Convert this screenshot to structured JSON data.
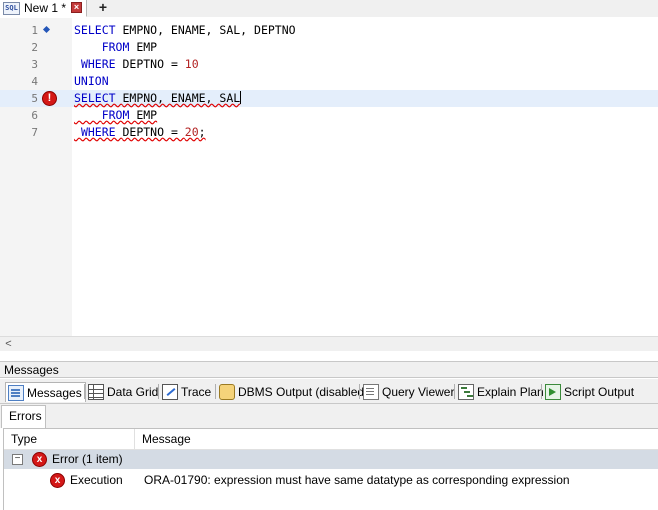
{
  "document_tab": {
    "icon": "sql-file-icon",
    "icon_text": "SQL",
    "title": "New 1 *",
    "close_glyph": "×",
    "add_glyph": "+"
  },
  "editor": {
    "lines": [
      {
        "number": "1",
        "marker": "bookmark",
        "segments": [
          {
            "text": "SELECT ",
            "cls": "kw"
          },
          {
            "text": "EMPNO, ENAME, SAL, DEPTNO",
            "cls": ""
          }
        ]
      },
      {
        "number": "2",
        "marker": "",
        "segments": [
          {
            "text": "    ",
            "cls": ""
          },
          {
            "text": "FROM ",
            "cls": "kw"
          },
          {
            "text": "EMP",
            "cls": ""
          }
        ]
      },
      {
        "number": "3",
        "marker": "",
        "segments": [
          {
            "text": " ",
            "cls": ""
          },
          {
            "text": "WHERE ",
            "cls": "kw"
          },
          {
            "text": "DEPTNO = ",
            "cls": ""
          },
          {
            "text": "10",
            "cls": "num"
          }
        ]
      },
      {
        "number": "4",
        "marker": "",
        "segments": [
          {
            "text": "UNION",
            "cls": "kw"
          }
        ]
      },
      {
        "number": "5",
        "marker": "error",
        "current": true,
        "segments": [
          {
            "text": "SELECT ",
            "cls": "kw squig"
          },
          {
            "text": "EMPNO, ENAME, SAL",
            "cls": "squig"
          }
        ]
      },
      {
        "number": "6",
        "marker": "",
        "segments": [
          {
            "text": "    ",
            "cls": "squig"
          },
          {
            "text": "FROM ",
            "cls": "kw squig"
          },
          {
            "text": "EMP",
            "cls": "squig"
          }
        ]
      },
      {
        "number": "7",
        "marker": "",
        "segments": [
          {
            "text": " ",
            "cls": "squig"
          },
          {
            "text": "WHERE ",
            "cls": "kw squig"
          },
          {
            "text": "DEPTNO = ",
            "cls": "squig"
          },
          {
            "text": "20",
            "cls": "num squig"
          },
          {
            "text": ";",
            "cls": "squig"
          }
        ]
      }
    ],
    "error_marker_glyph": "!"
  },
  "scrollbar": {
    "left_arrow": "<"
  },
  "messages_panel": {
    "title": "Messages",
    "tabs": [
      {
        "label": "Messages",
        "icon": "messages-icon",
        "active": true
      },
      {
        "label": "Data Grid",
        "icon": "data-grid-icon",
        "active": false
      },
      {
        "label": "Trace",
        "icon": "trace-icon",
        "active": false
      },
      {
        "label": "DBMS Output (disabled)",
        "icon": "dbms-output-icon",
        "active": false
      },
      {
        "label": "Query Viewer",
        "icon": "query-viewer-icon",
        "active": false
      },
      {
        "label": "Explain Plan",
        "icon": "explain-plan-icon",
        "active": false
      },
      {
        "label": "Script Output",
        "icon": "script-output-icon",
        "active": false
      }
    ],
    "subtab": "Errors",
    "columns": {
      "type": "Type",
      "message": "Message"
    },
    "group": {
      "expander": "−",
      "icon_glyph": "x",
      "label": "Error (1 item)"
    },
    "rows": [
      {
        "type": "Execution",
        "message": "ORA-01790: expression must have same datatype as corresponding expression"
      }
    ]
  }
}
